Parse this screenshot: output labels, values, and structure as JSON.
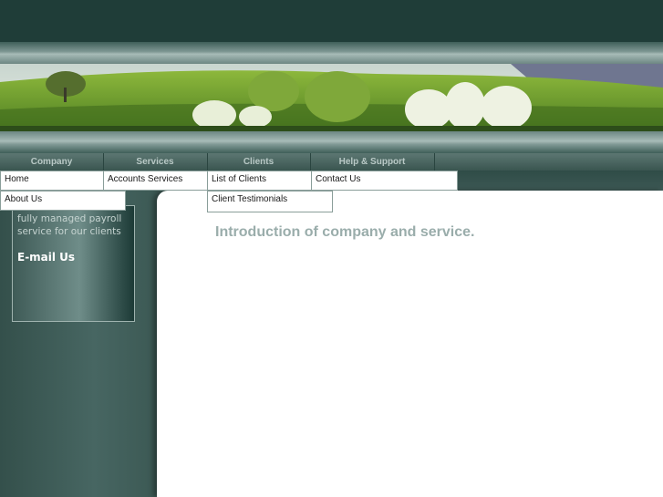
{
  "nav": {
    "tabs": [
      {
        "label": "Company"
      },
      {
        "label": "Services"
      },
      {
        "label": "Clients"
      },
      {
        "label": "Help & Support"
      }
    ]
  },
  "dropdowns": {
    "company": [
      "Home",
      "About Us"
    ],
    "services": [
      "Accounts Services"
    ],
    "clients": [
      "List of Clients",
      "Client Testimonials"
    ],
    "help": [
      "Contact Us"
    ]
  },
  "sidebar": {
    "text": "fully managed payroll service for our clients",
    "email_link": "E-mail Us"
  },
  "main": {
    "intro": "Introduction of company and service."
  },
  "colors": {
    "header": "#1f3d38",
    "sidebar": "#3d5854",
    "nav_text": "#b9c9c6",
    "intro_text": "#9aadab"
  }
}
